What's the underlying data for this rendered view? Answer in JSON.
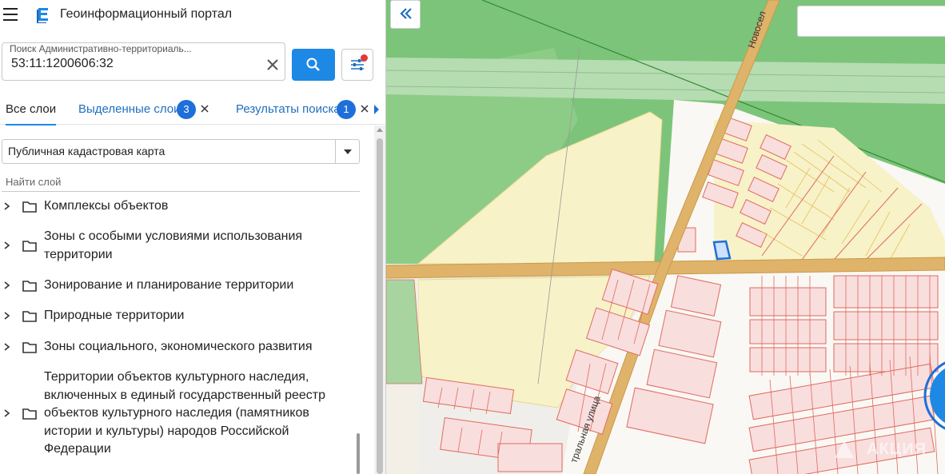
{
  "header": {
    "title": "Геоинформационный портал"
  },
  "search": {
    "label": "Поиск Административно-территориаль...",
    "value": "53:11:1200606:32"
  },
  "tabs": [
    {
      "label": "Все слои",
      "active": true
    },
    {
      "label": "Выделенные слои",
      "badge": "3"
    },
    {
      "label": "Результаты поиска",
      "badge": "1"
    }
  ],
  "layer_select": {
    "selected": "Публичная кадастровая карта"
  },
  "find_layer": {
    "placeholder": "Найти слой"
  },
  "layers": [
    {
      "label": "Комплексы объектов"
    },
    {
      "label": "Зоны с особыми условиями использования территории"
    },
    {
      "label": "Зонирование и планирование территории"
    },
    {
      "label": "Природные территории"
    },
    {
      "label": "Зоны социального, экономического развития"
    },
    {
      "label": "Территории объектов культурного наследия, включенных в единый государственный реестр объектов культурного наследия (памятников истории и культуры) народов Российской Федерации"
    }
  ],
  "map": {
    "street_labels": [
      "Новосел",
      "тральная улица"
    ],
    "watermark": "АКЦИЯ"
  },
  "colors": {
    "accent": "#1e88e5",
    "badge": "#1e6fd9",
    "forest": "#7cc47a",
    "plot_fill": "#f7f2c8",
    "parcel_border": "#e06a5e",
    "road": "#e0b36a"
  },
  "icons": [
    "menu-icon",
    "portal-logo-icon",
    "clear-icon",
    "search-icon",
    "filter-settings-icon",
    "close-icon",
    "chevron-right-icon",
    "folder-icon",
    "double-chevron-left-icon"
  ]
}
